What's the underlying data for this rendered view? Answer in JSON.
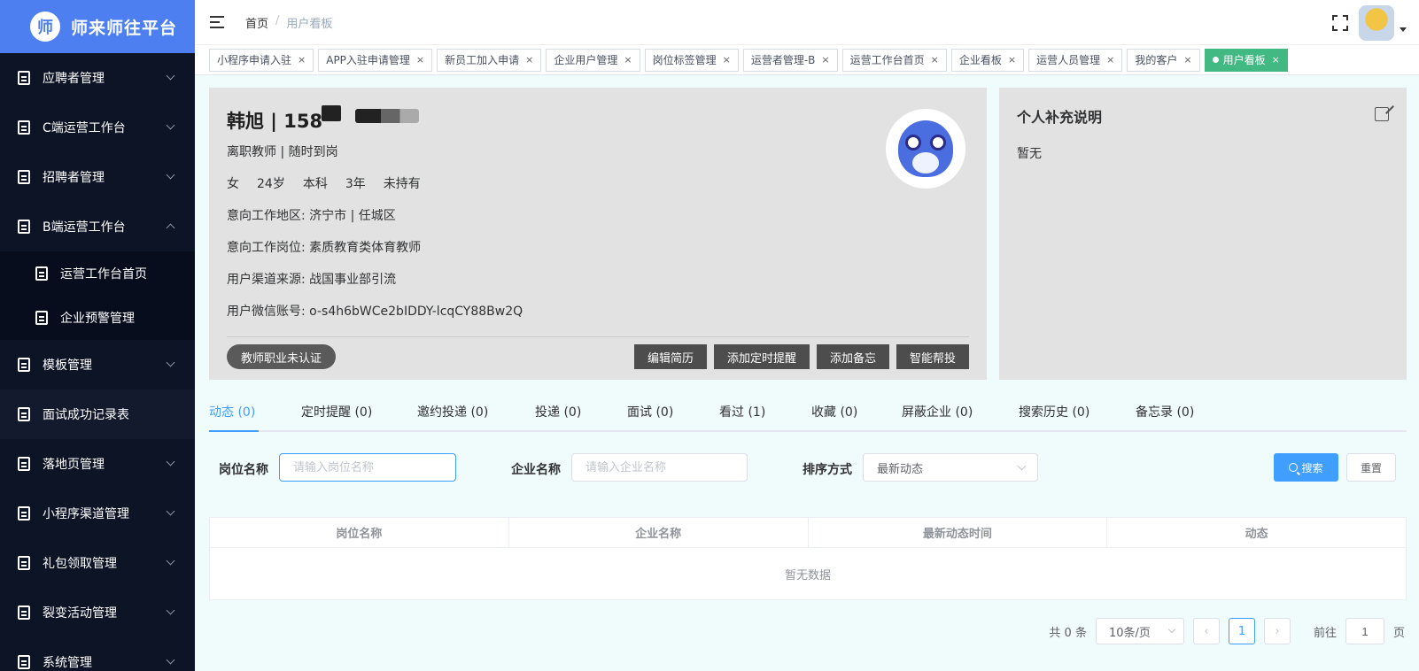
{
  "app": {
    "logo_char": "师",
    "title": "师来师往平台"
  },
  "sidebar": {
    "items": [
      {
        "label": "应聘者管理"
      },
      {
        "label": "C端运营工作台"
      },
      {
        "label": "招聘者管理"
      },
      {
        "label": "B端运营工作台",
        "expanded": true
      },
      {
        "label": "模板管理"
      },
      {
        "label": "面试成功记录表"
      },
      {
        "label": "落地页管理"
      },
      {
        "label": "小程序渠道管理"
      },
      {
        "label": "礼包领取管理"
      },
      {
        "label": "裂变活动管理"
      },
      {
        "label": "系统管理"
      }
    ],
    "sub_items": [
      {
        "label": "运营工作台首页"
      },
      {
        "label": "企业预警管理"
      }
    ]
  },
  "breadcrumb": {
    "home": "首页",
    "separator": "/",
    "current": "用户看板"
  },
  "tags": [
    {
      "label": "小程序申请入驻"
    },
    {
      "label": "APP入驻申请管理"
    },
    {
      "label": "新员工加入申请"
    },
    {
      "label": "企业用户管理"
    },
    {
      "label": "岗位标签管理"
    },
    {
      "label": "运营者管理-B"
    },
    {
      "label": "运营工作台首页"
    },
    {
      "label": "企业看板"
    },
    {
      "label": "运营人员管理"
    },
    {
      "label": "我的客户"
    },
    {
      "label": "用户看板",
      "active": true
    }
  ],
  "profile": {
    "name": "韩旭 | 158",
    "status": "离职教师 | 随时到岗",
    "basic": {
      "gender": "女",
      "age": "24岁",
      "education": "本科",
      "experience": "3年",
      "certificate": "未持有"
    },
    "area_label": "意向工作地区:",
    "area_value": "济宁市 | 任城区",
    "post_label": "意向工作岗位:",
    "post_value": "素质教育类体育教师",
    "source_label": "用户渠道来源:",
    "source_value": "战国事业部引流",
    "wechat_label": "用户微信账号:",
    "wechat_value": "o-s4h6bWCe2bIDDY-lcqCY88Bw2Q",
    "cert_badge": "教师职业未认证",
    "actions": [
      "编辑简历",
      "添加定时提醒",
      "添加备忘",
      "智能帮投"
    ]
  },
  "note": {
    "title": "个人补充说明",
    "body": "暂无"
  },
  "tabs": [
    {
      "label": "动态 (0)",
      "active": true
    },
    {
      "label": "定时提醒 (0)"
    },
    {
      "label": "邀约投递 (0)"
    },
    {
      "label": "投递 (0)"
    },
    {
      "label": "面试 (0)"
    },
    {
      "label": "看过 (1)"
    },
    {
      "label": "收藏 (0)"
    },
    {
      "label": "屏蔽企业 (0)"
    },
    {
      "label": "搜索历史 (0)"
    },
    {
      "label": "备忘录 (0)"
    }
  ],
  "filters": {
    "job_label": "岗位名称",
    "job_placeholder": "请输入岗位名称",
    "company_label": "企业名称",
    "company_placeholder": "请输入企业名称",
    "sort_label": "排序方式",
    "sort_value": "最新动态",
    "search_label": "搜索",
    "reset_label": "重置"
  },
  "table": {
    "columns": [
      "岗位名称",
      "企业名称",
      "最新动态时间",
      "动态"
    ],
    "empty_text": "暂无数据"
  },
  "pagination": {
    "total": "共 0 条",
    "page_size": "10条/页",
    "current": "1",
    "goto_label": "前往",
    "goto_value": "1",
    "page_suffix": "页"
  },
  "colors": {
    "sidebar_bg": "#0d1426",
    "logo_bg": "#4e7ff0",
    "primary": "#409eff",
    "active_tag": "#42b983"
  }
}
